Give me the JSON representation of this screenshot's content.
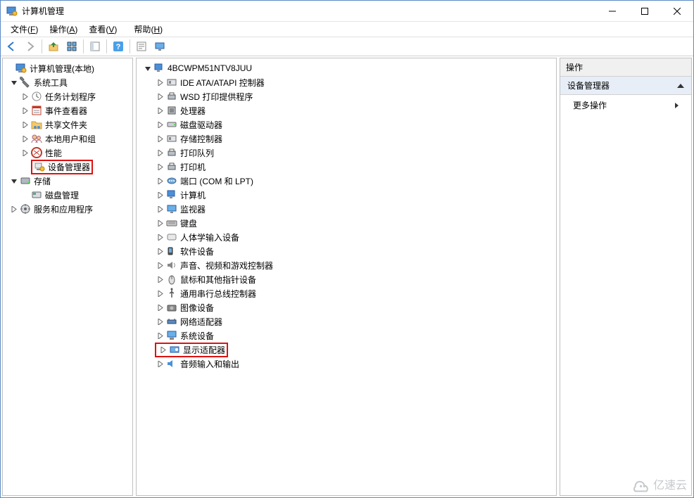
{
  "window": {
    "title": "计算机管理"
  },
  "menu": {
    "file": {
      "label": "文件",
      "hotkey": "F"
    },
    "action": {
      "label": "操作",
      "hotkey": "A"
    },
    "view": {
      "label": "查看",
      "hotkey": "V"
    },
    "help": {
      "label": "帮助",
      "hotkey": "H"
    }
  },
  "left_tree": {
    "root": {
      "label": "计算机管理(本地)"
    },
    "system_tools": {
      "label": "系统工具",
      "children": {
        "task_scheduler": "任务计划程序",
        "event_viewer": "事件查看器",
        "shared_folders": "共享文件夹",
        "local_users": "本地用户和组",
        "performance": "性能",
        "device_manager": "设备管理器"
      }
    },
    "storage": {
      "label": "存储",
      "children": {
        "disk_mgmt": "磁盘管理"
      }
    },
    "services": {
      "label": "服务和应用程序"
    }
  },
  "mid_tree": {
    "root": {
      "label": "4BCWPM51NTV8JUU"
    },
    "items": {
      "ide": "IDE ATA/ATAPI 控制器",
      "wsd": "WSD 打印提供程序",
      "cpu": "处理器",
      "disk_drive": "磁盘驱动器",
      "storage_ctrl": "存储控制器",
      "print_queue": "打印队列",
      "printer": "打印机",
      "ports": "端口 (COM 和 LPT)",
      "computer": "计算机",
      "monitor": "监视器",
      "keyboard": "键盘",
      "hid": "人体学输入设备",
      "software_dev": "软件设备",
      "sound": "声音、视频和游戏控制器",
      "mouse": "鼠标和其他指针设备",
      "usb": "通用串行总线控制器",
      "imaging": "图像设备",
      "network": "网络适配器",
      "system_dev": "系统设备",
      "display": "显示适配器",
      "audio_io": "音频输入和输出"
    }
  },
  "actions": {
    "header": "操作",
    "section": "设备管理器",
    "more": "更多操作"
  },
  "watermark": "亿速云"
}
